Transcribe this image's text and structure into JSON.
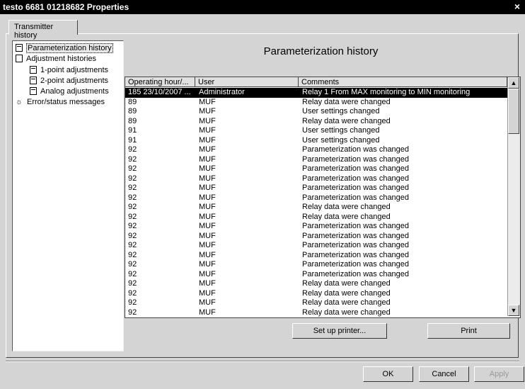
{
  "window": {
    "title": "testo 6681  01218682 Properties",
    "close_label": "×"
  },
  "tabs": [
    {
      "label": "Transmitter history"
    }
  ],
  "tree": {
    "items": [
      {
        "label": "Parameterization history",
        "selected": true
      },
      {
        "label": "Adjustment histories"
      },
      {
        "label": "1-point adjustments"
      },
      {
        "label": "2-point adjustments"
      },
      {
        "label": "Analog adjustments"
      },
      {
        "label": "Error/status messages"
      }
    ]
  },
  "main": {
    "heading": "Parameterization history",
    "table": {
      "columns": [
        "Operating hour/...",
        "User",
        "Comments"
      ],
      "rows": [
        [
          "185 23/10/2007 ...",
          "Administrator",
          "Relay 1 From MAX monitoring to MIN monitoring"
        ],
        [
          "89",
          "MUF",
          "Relay data were changed"
        ],
        [
          "89",
          "MUF",
          "User settings changed"
        ],
        [
          "89",
          "MUF",
          "Relay data were changed"
        ],
        [
          "91",
          "MUF",
          "User settings changed"
        ],
        [
          "91",
          "MUF",
          "User settings changed"
        ],
        [
          "92",
          "MUF",
          "Parameterization was changed"
        ],
        [
          "92",
          "MUF",
          "Parameterization was changed"
        ],
        [
          "92",
          "MUF",
          "Parameterization was changed"
        ],
        [
          "92",
          "MUF",
          "Parameterization was changed"
        ],
        [
          "92",
          "MUF",
          "Parameterization was changed"
        ],
        [
          "92",
          "MUF",
          "Parameterization was changed"
        ],
        [
          "92",
          "MUF",
          "Relay data were changed"
        ],
        [
          "92",
          "MUF",
          "Relay data were changed"
        ],
        [
          "92",
          "MUF",
          "Parameterization was changed"
        ],
        [
          "92",
          "MUF",
          "Parameterization was changed"
        ],
        [
          "92",
          "MUF",
          "Parameterization was changed"
        ],
        [
          "92",
          "MUF",
          "Parameterization was changed"
        ],
        [
          "92",
          "MUF",
          "Parameterization was changed"
        ],
        [
          "92",
          "MUF",
          "Parameterization was changed"
        ],
        [
          "92",
          "MUF",
          "Relay data were changed"
        ],
        [
          "92",
          "MUF",
          "Relay data were changed"
        ],
        [
          "92",
          "MUF",
          "Relay data were changed"
        ],
        [
          "92",
          "MUF",
          "Relay data were changed"
        ]
      ],
      "selected_row": 0
    },
    "setup_printer_label": "Set up printer...",
    "print_label": "Print"
  },
  "footer": {
    "ok_label": "OK",
    "cancel_label": "Cancel",
    "apply_label": "Apply"
  }
}
